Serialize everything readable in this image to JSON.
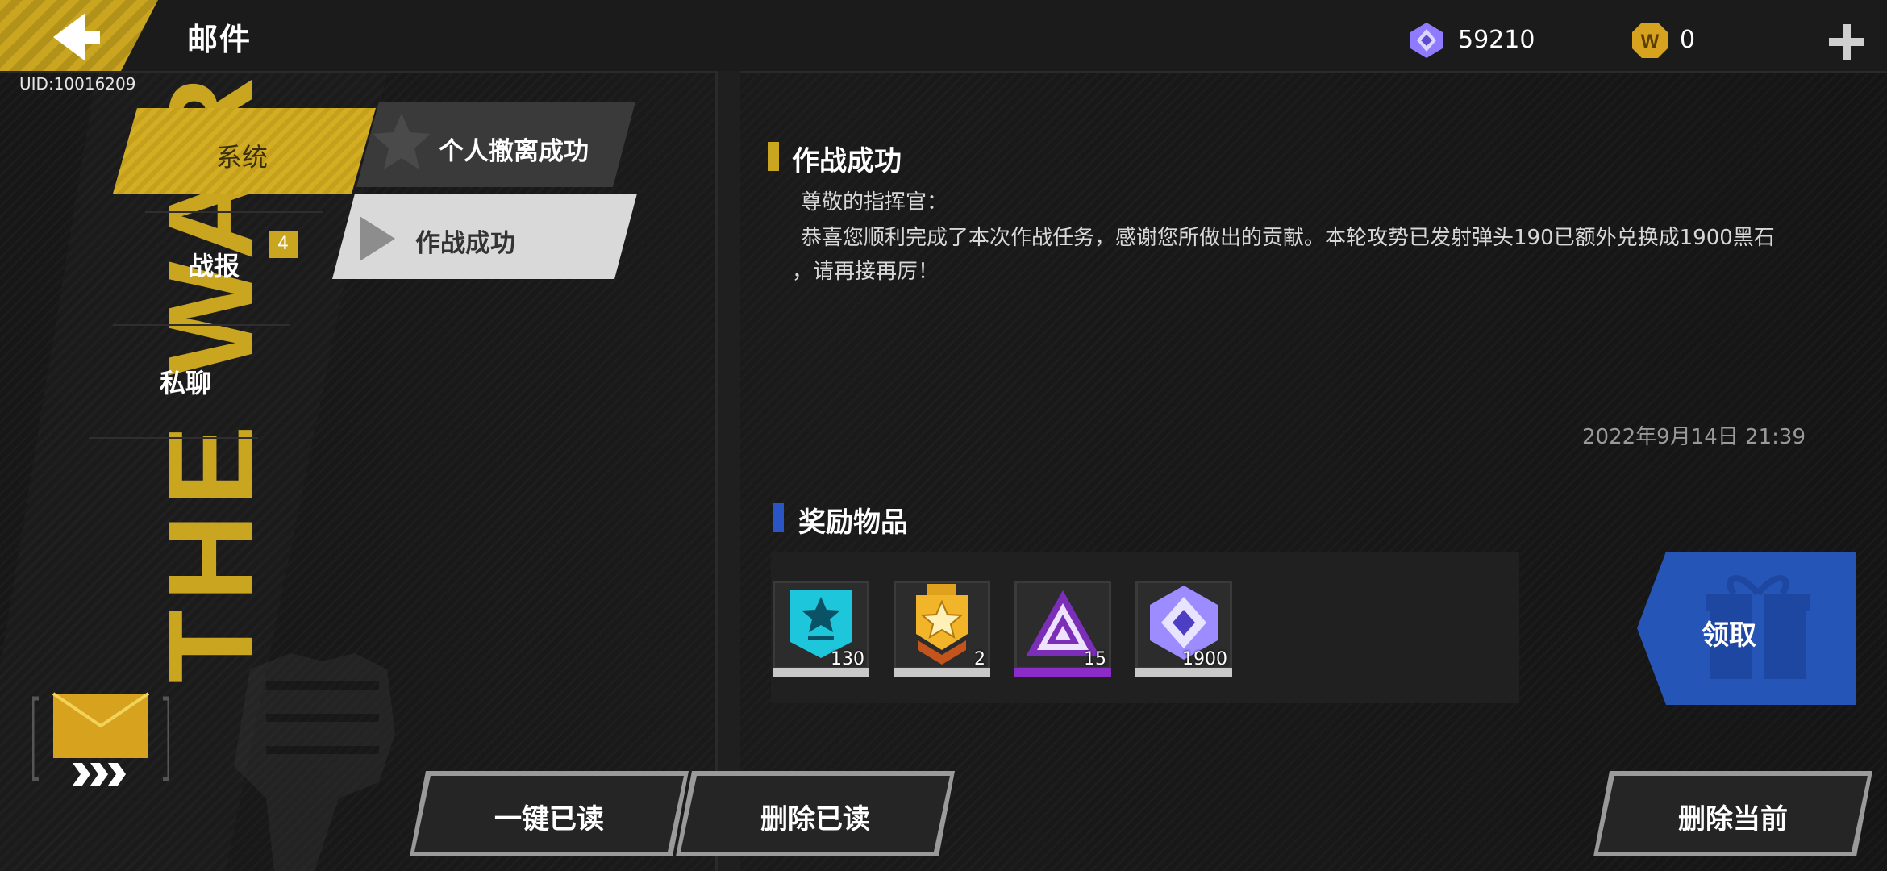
{
  "header": {
    "title": "邮件",
    "uid": "UID:10016209",
    "currencies": [
      {
        "icon": "crystal-icon",
        "value": "59210",
        "color": "#8a7bff"
      },
      {
        "icon": "w-coin-icon",
        "value": "0",
        "color": "#d7a21e"
      }
    ]
  },
  "sidebar": {
    "items": [
      {
        "label": "系统",
        "active": true
      },
      {
        "label": "战报",
        "badge": "4"
      },
      {
        "label": "私聊"
      }
    ]
  },
  "mail_list": [
    {
      "title": "个人撤离成功",
      "icon": "star-icon"
    },
    {
      "title": "作战成功",
      "icon": "triangle-arrow-icon",
      "selected": true
    }
  ],
  "mail": {
    "title": "作战成功",
    "greeting": "尊敬的指挥官：",
    "body_line1": "恭喜您顺利完成了本次作战任务，感谢您所做出的贡献。本轮攻势已发射弹头190已额外兑换成1900黑石",
    "body_line2": "，请再接再厉！",
    "date": "2022年9月14日  21:39"
  },
  "rewards": {
    "title": "奖励物品",
    "items": [
      {
        "icon": "cyan-badge-icon",
        "count": "130",
        "bar_color": "#c9c9c9"
      },
      {
        "icon": "gold-medal-icon",
        "count": "2",
        "bar_color": "#c9c9c9"
      },
      {
        "icon": "purple-triangle-icon",
        "count": "15",
        "bar_color": "#8b2cc8"
      },
      {
        "icon": "crystal-icon",
        "count": "1900",
        "bar_color": "#c9c9c9"
      }
    ],
    "claim_label": "领取"
  },
  "buttons": {
    "read_all": "一键已读",
    "delete_read": "删除已读",
    "delete_current": "删除当前"
  },
  "colors": {
    "accent_yellow": "#c9a520",
    "claim_blue": "#2655b8",
    "title_mark_yellow": "#c9a520",
    "title_mark_blue": "#2a55c4"
  }
}
